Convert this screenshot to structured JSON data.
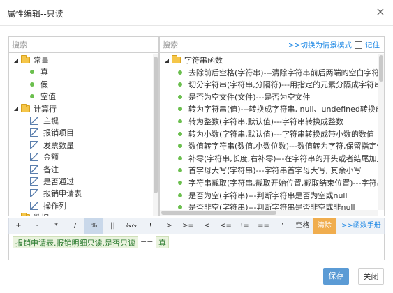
{
  "dialog": {
    "title": "属性编辑--只读",
    "close_icon": "close-icon",
    "close_glyph": "×"
  },
  "left_panel": {
    "search_placeholder": "搜索",
    "tree": [
      {
        "type": "group",
        "icon": "folder-icon",
        "label": "常量",
        "expanded": true,
        "indent": 0
      },
      {
        "type": "leaf",
        "icon": "green-dot-icon",
        "label": "真",
        "indent": 1
      },
      {
        "type": "leaf",
        "icon": "green-dot-icon",
        "label": "假",
        "indent": 1
      },
      {
        "type": "leaf",
        "icon": "green-dot-icon",
        "label": "空值",
        "indent": 1
      },
      {
        "type": "group",
        "icon": "folder-icon",
        "label": "计算行",
        "expanded": true,
        "indent": 0
      },
      {
        "type": "field",
        "icon": "field-icon",
        "label": "主键",
        "indent": 1
      },
      {
        "type": "field",
        "icon": "field-icon",
        "label": "报销项目",
        "indent": 1
      },
      {
        "type": "field",
        "icon": "field-icon",
        "label": "发票数量",
        "indent": 1
      },
      {
        "type": "field",
        "icon": "field-icon",
        "label": "金额",
        "indent": 1
      },
      {
        "type": "field",
        "icon": "field-icon",
        "label": "备注",
        "indent": 1
      },
      {
        "type": "field",
        "icon": "field-icon",
        "label": "是否通过",
        "indent": 1
      },
      {
        "type": "field",
        "icon": "field-icon",
        "label": "报销申请表",
        "indent": 1
      },
      {
        "type": "field",
        "icon": "field-icon",
        "label": "操作列",
        "indent": 1
      },
      {
        "type": "group",
        "icon": "folder-icon",
        "label": "数据",
        "expanded": false,
        "indent": 0
      }
    ]
  },
  "right_panel": {
    "search_placeholder": "搜索",
    "switch_label": ">>切换为情景模式",
    "remember_label": "记住",
    "group_label": "字符串函数",
    "functions": [
      "去除前后空格(字符串)---清除字符串前后两端的空白字符",
      "切分字符串(字符串,分隔符)---用指定的元素分隔成字符串数组, 并对",
      "是否为空文件(文件)---是否为空文件",
      "转为字符串(值)---转换成字符串, null、undefined转换成空字符串",
      "转为整数(字符串,默认值)---字符串转换成整数",
      "转为小数(字符串,默认值)---字符串转换成带小数的数值",
      "数值转字符串(数值,小数位数)---数值转为字符,保留指定位数小数",
      "补零(字符串,长度,右补零)---在字符串的开头或者结尾加上几个零,达",
      "首字母大写(字符串)---字符串首字母大写, 其余小写",
      "字符串截取(字符串,截取开始位置,截取结束位置)---字符串截取",
      "是否为空(字符串)---判断字符串是否为空或null",
      "是否非空(字符串)---判断字符串是否非空或非null"
    ]
  },
  "operators": [
    "+",
    "-",
    "*",
    "/",
    "%",
    "||",
    "&&",
    "!",
    ">",
    ">=",
    "<",
    "<=",
    "!=",
    "==",
    "'",
    "空格"
  ],
  "active_operator": "%",
  "clear_label": "清除",
  "manual_link": ">>函数手册",
  "expression": {
    "field_token": "报销申请表.报销明细只读.是否只读",
    "operator": "==",
    "value_token": "真"
  },
  "buttons": {
    "save": "保存",
    "close": "关闭"
  },
  "colors": {
    "accent": "#1e88e5",
    "save_button": "#5b9bd5",
    "clear_button": "#f0ad4e",
    "active_operator_bg": "#c9d8ea",
    "token_bg": "#eaf3de"
  }
}
